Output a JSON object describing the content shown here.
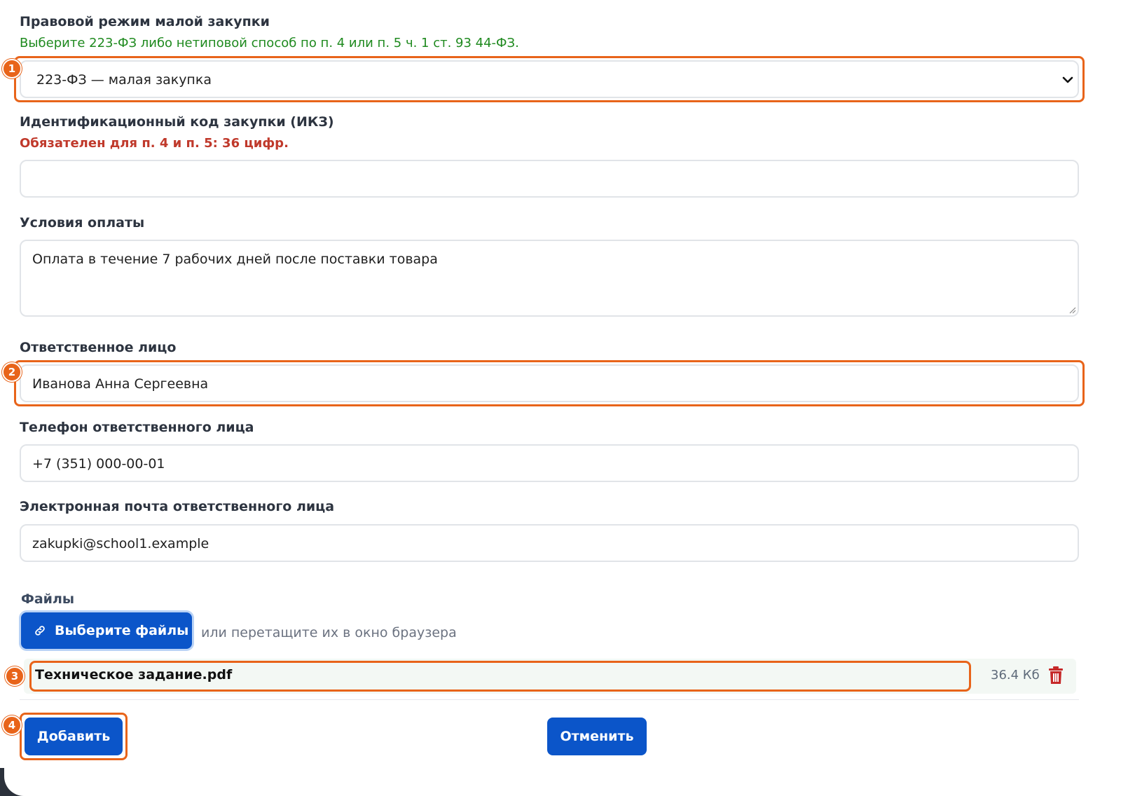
{
  "procurement_mode": {
    "label": "Правовой режим малой закупки",
    "hint": "Выберите 223-ФЗ либо нетиповой способ по п. 4 или п. 5 ч. 1 ст. 93 44-ФЗ.",
    "selected": "223-ФЗ — малая закупка"
  },
  "ikz": {
    "label": "Идентификационный код закупки (ИКЗ)",
    "hint": "Обязателен для п. 4 и п. 5: 36 цифр.",
    "value": ""
  },
  "payment_terms": {
    "label": "Условия оплаты",
    "value": "Оплата в течение 7 рабочих дней после поставки товара"
  },
  "responsible": {
    "label": "Ответственное лицо",
    "value": "Иванова Анна Сергеевна"
  },
  "phone": {
    "label": "Телефон ответственного лица",
    "value": "+7 (351) 000-00-01"
  },
  "email": {
    "label": "Электронная почта ответственного лица",
    "value": "zakupki@school1.example"
  },
  "files": {
    "label": "Файлы",
    "choose_label": "Выберите файлы",
    "drop_hint": "или перетащите их в окно браузера",
    "items": [
      {
        "name": "Техническое задание.pdf",
        "size": "36.4 Кб"
      }
    ]
  },
  "actions": {
    "add_label": "Добавить",
    "cancel_label": "Отменить"
  },
  "badges": [
    "1",
    "2",
    "3",
    "4"
  ],
  "colors": {
    "primary": "#0b55c9",
    "highlight": "#e8641a",
    "hint_green": "#1f8a1f",
    "hint_red": "#c0392b",
    "trash": "#c62828"
  }
}
